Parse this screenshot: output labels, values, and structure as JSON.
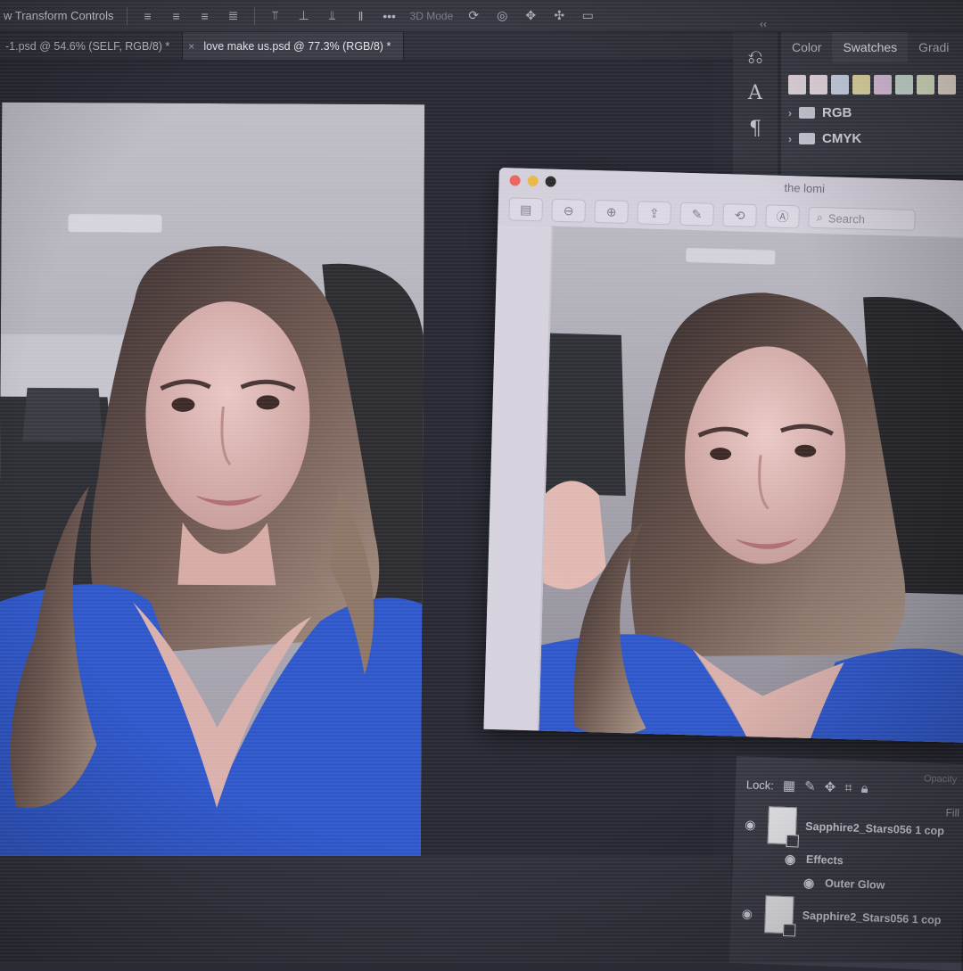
{
  "options_bar": {
    "label": "w Transform Controls",
    "more": "•••",
    "mode": "3D Mode"
  },
  "tabs": [
    {
      "label": "-1.psd @ 54.6% (SELF, RGB/8) *",
      "close": "",
      "active": false
    },
    {
      "label": "love make us.psd @ 77.3% (RGB/8) *",
      "close": "×",
      "active": true
    }
  ],
  "color_panel": {
    "tabs": [
      "Color",
      "Swatches",
      "Gradi"
    ],
    "active_tab": "Swatches",
    "swatches": [
      "#e6d9e2",
      "#ecdde6",
      "#cfd8ec",
      "#e8dda8",
      "#e1c8e4",
      "#cfe0d8",
      "#dfe6c8",
      "#e9ded2"
    ],
    "folders": [
      "RGB",
      "CMYK"
    ]
  },
  "preview": {
    "title": "the lomi",
    "search_placeholder": "Search",
    "colors": {
      "close": "#e8655c",
      "min": "#e8b84a",
      "max": "#2b2b2b"
    }
  },
  "layers": {
    "opacity_label": "Opacity",
    "lock_label": "Lock:",
    "fill_label": "Fill",
    "items": [
      {
        "name": "Sapphire2_Stars056 1 cop",
        "effects_label": "Effects",
        "effect": "Outer Glow"
      },
      {
        "name": "Sapphire2_Stars056 1 cop"
      }
    ]
  }
}
